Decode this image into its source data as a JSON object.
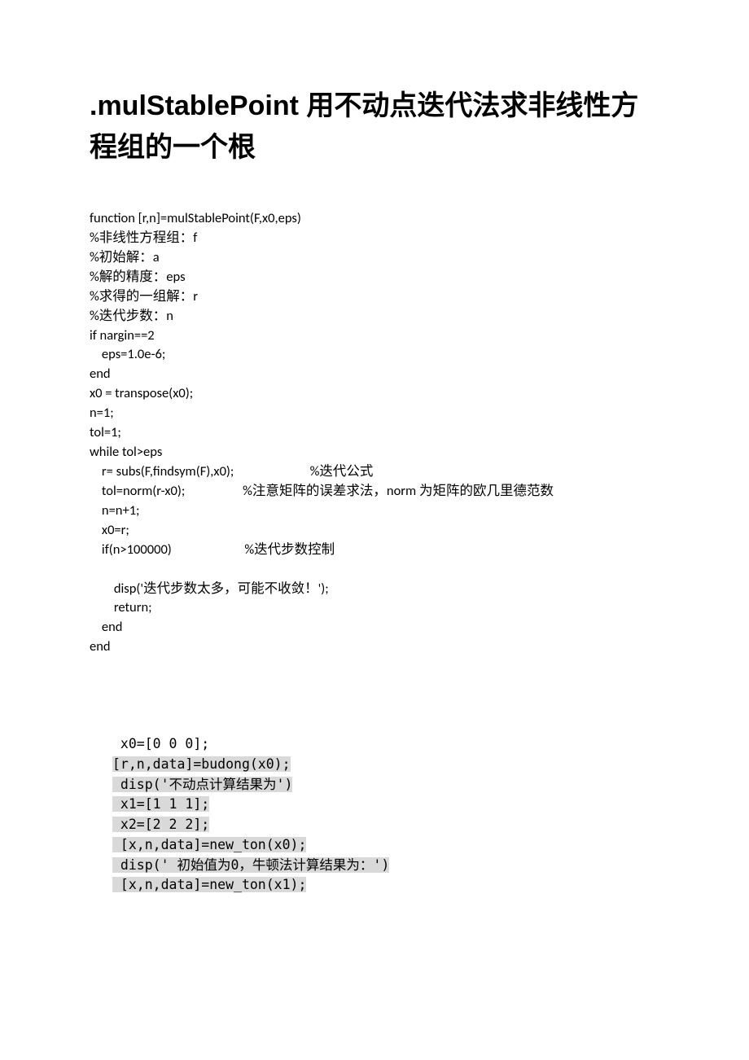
{
  "title": {
    "code": ".mulStablePoint",
    "rest": " 用不动点迭代法求非线性方程组的一个根"
  },
  "code_block": "function [r,n]=mulStablePoint(F,x0,eps)\n%非线性方程组：f\n%初始解：a\n%解的精度：eps\n%求得的一组解：r\n%迭代步数：n\nif nargin==2\n    eps=1.0e-6;\nend\nx0 = transpose(x0);\nn=1;\ntol=1;\nwhile tol>eps\n    r= subs(F,findsym(F),x0);                         %迭代公式\n    tol=norm(r-x0);                   %注意矩阵的误差求法，norm 为矩阵的欧几里德范数\n    n=n+1;\n    x0=r;\n    if(n>100000)                        %迭代步数控制\n       \n        disp('迭代步数太多，可能不收敛！');\n        return;\n    end\nend",
  "example": {
    "line0": " x0=[0 0 0];",
    "line1": "[r,n,data]=budong(x0);",
    "line2": " disp('不动点计算结果为')",
    "line3": " x1=[1 1 1];",
    "line4": " x2=[2 2 2];",
    "line5": " [x,n,data]=new_ton(x0);",
    "line6": " disp(' 初始值为0，牛顿法计算结果为：')",
    "line7": " [x,n,data]=new_ton(x1);"
  }
}
